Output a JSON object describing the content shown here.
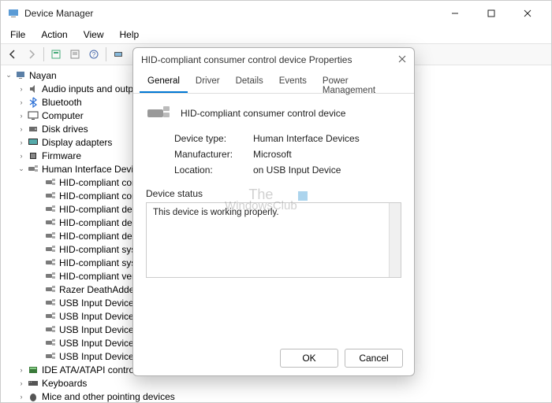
{
  "window": {
    "title": "Device Manager",
    "menu": [
      "File",
      "Action",
      "View",
      "Help"
    ]
  },
  "tree": {
    "root": "Nayan",
    "nodes": [
      {
        "label": "Audio inputs and outp",
        "icon": "sound-icon",
        "expandable": true
      },
      {
        "label": "Bluetooth",
        "icon": "bluetooth-icon",
        "expandable": true
      },
      {
        "label": "Computer",
        "icon": "monitor-icon",
        "expandable": true
      },
      {
        "label": "Disk drives",
        "icon": "disk-icon",
        "expandable": true
      },
      {
        "label": "Display adapters",
        "icon": "display-icon",
        "expandable": true
      },
      {
        "label": "Firmware",
        "icon": "firmware-icon",
        "expandable": true
      },
      {
        "label": "Human Interface Device",
        "icon": "hid-icon",
        "expanded": true,
        "expandable": true,
        "children": [
          "HID-compliant cons",
          "HID-compliant cons",
          "HID-compliant devi",
          "HID-compliant devi",
          "HID-compliant devi",
          "HID-compliant syste",
          "HID-compliant syste",
          "HID-compliant vend",
          "Razer DeathAdder V",
          "USB Input Device",
          "USB Input Device",
          "USB Input Device",
          "USB Input Device",
          "USB Input Device"
        ]
      },
      {
        "label": "IDE ATA/ATAPI controller",
        "icon": "ide-icon",
        "expandable": true
      },
      {
        "label": "Keyboards",
        "icon": "keyboard-icon",
        "expandable": true
      },
      {
        "label": "Mice and other pointing devices",
        "icon": "mouse-icon",
        "expandable": true
      }
    ]
  },
  "dialog": {
    "title": "HID-compliant consumer control device Properties",
    "tabs": [
      "General",
      "Driver",
      "Details",
      "Events",
      "Power Management"
    ],
    "active_tab": "General",
    "device_name": "HID-compliant consumer control device",
    "info": [
      {
        "label": "Device type:",
        "value": "Human Interface Devices"
      },
      {
        "label": "Manufacturer:",
        "value": "Microsoft"
      },
      {
        "label": "Location:",
        "value": "on USB Input Device"
      }
    ],
    "status_label": "Device status",
    "status_text": "This device is working properly.",
    "buttons": {
      "ok": "OK",
      "cancel": "Cancel"
    }
  },
  "watermark": {
    "line1": "The",
    "line2": "WindowsClub"
  }
}
